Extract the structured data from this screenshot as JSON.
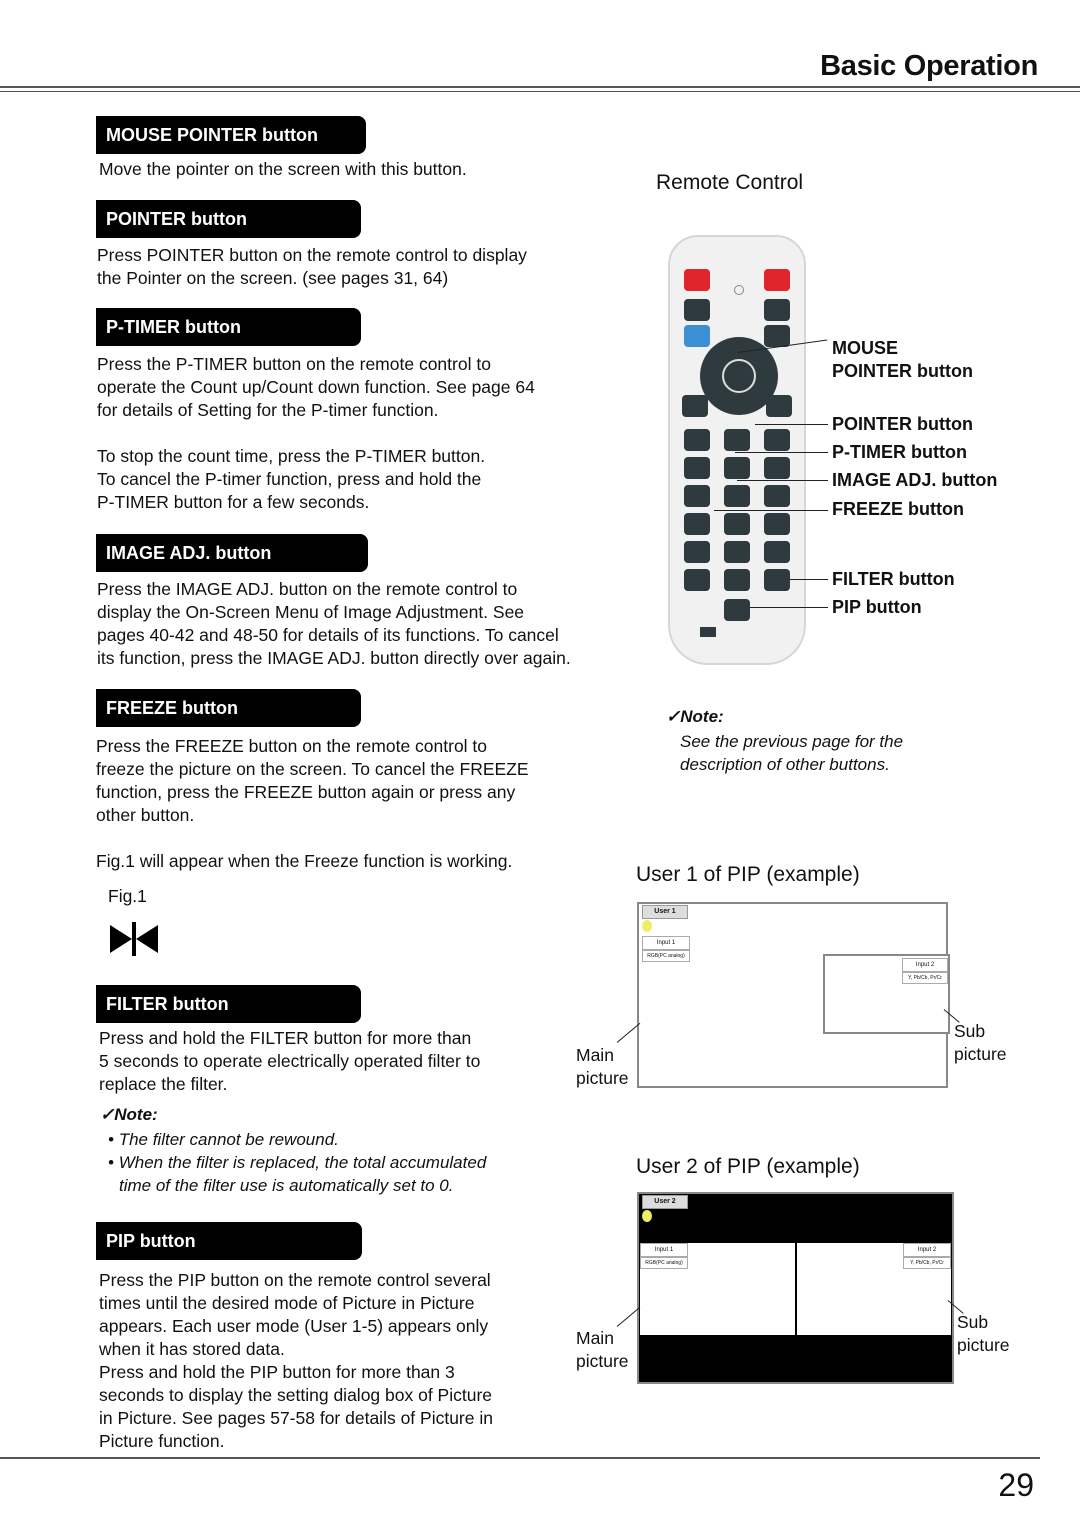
{
  "header": {
    "title": "Basic Operation"
  },
  "footer": {
    "page_number": "29"
  },
  "sections": [
    {
      "heading": "MOUSE POINTER button",
      "text": [
        "Move the pointer on the screen with this button."
      ]
    },
    {
      "heading": "POINTER button",
      "text": [
        "Press POINTER button on the remote control to display",
        "the Pointer on the screen. (see pages 31, 64)"
      ]
    },
    {
      "heading": "P-TIMER button",
      "text": [
        "Press the P-TIMER button on the remote control to",
        "operate the Count up/Count down function. See page 64",
        "for details of Setting for the P-timer function."
      ],
      "text2": [
        "To stop the count time, press the P-TIMER button.",
        "To cancel the P-timer function, press and hold the",
        "P-TIMER button for a few seconds."
      ]
    },
    {
      "heading": "IMAGE ADJ. button",
      "text": [
        "Press the IMAGE ADJ. button on the remote control to",
        "display the On-Screen Menu of Image Adjustment. See",
        "pages 40-42 and 48-50 for details of its functions. To cancel",
        "its function, press the IMAGE ADJ. button directly over again."
      ]
    },
    {
      "heading": "FREEZE button",
      "text": [
        "Press the FREEZE button on the remote control to",
        "freeze the picture on the screen. To cancel the FREEZE",
        "function, press the FREEZE button again or press any",
        "other button."
      ],
      "text2": [
        "Fig.1 will appear when the Freeze function is working."
      ],
      "fig_label": "Fig.1"
    },
    {
      "heading": "FILTER button",
      "text": [
        "Press and hold the FILTER button for more than",
        "5 seconds to operate electrically operated filter to",
        "replace the filter."
      ],
      "note_title": "Note:",
      "notes": [
        "The filter cannot be rewound.",
        "When the filter is replaced, the total accumulated",
        "time of the filter use is automatically set to 0."
      ]
    },
    {
      "heading": "PIP button",
      "text": [
        "Press the PIP button on the remote control several",
        "times until the desired mode of Picture in Picture",
        "appears. Each user mode (User 1-5) appears only",
        "when it has stored data.",
        "Press and hold the PIP button for more than 3",
        "seconds to display the setting dialog box of Picture",
        "in Picture. See pages 57-58 for details of Picture in",
        "Picture function."
      ]
    }
  ],
  "remote": {
    "title": "Remote Control",
    "callouts": [
      "MOUSE",
      "POINTER button",
      "POINTER button",
      "P-TIMER button",
      "IMAGE ADJ. button",
      "FREEZE button",
      "FILTER button",
      "PIP button"
    ],
    "note_title": "Note:",
    "note_text": [
      "See the previous page for the",
      "description of other buttons."
    ]
  },
  "pip_examples": [
    {
      "title": "User 1 of PIP (example)",
      "tab": "User 1",
      "main_input": "Input 1",
      "main_signal": "RGB(PC analog)",
      "sub_input": "Input 2",
      "sub_signal": "Y, Pb/Cb, Pr/Cr",
      "main_label": [
        "Main",
        "picture"
      ],
      "sub_label": [
        "Sub",
        "picture"
      ]
    },
    {
      "title": "User 2 of PIP (example)",
      "tab": "User 2",
      "main_input": "Input 1",
      "main_signal": "RGB(PC analog)",
      "sub_input": "Input 2",
      "sub_signal": "Y, Pb/Cb, Pr/Cr",
      "main_label": [
        "Main",
        "picture"
      ],
      "sub_label": [
        "Sub",
        "picture"
      ]
    }
  ],
  "colors": {
    "heading_bg": "#000000",
    "remote_on": "#e0252b",
    "remote_menu": "#3c8fd3"
  }
}
